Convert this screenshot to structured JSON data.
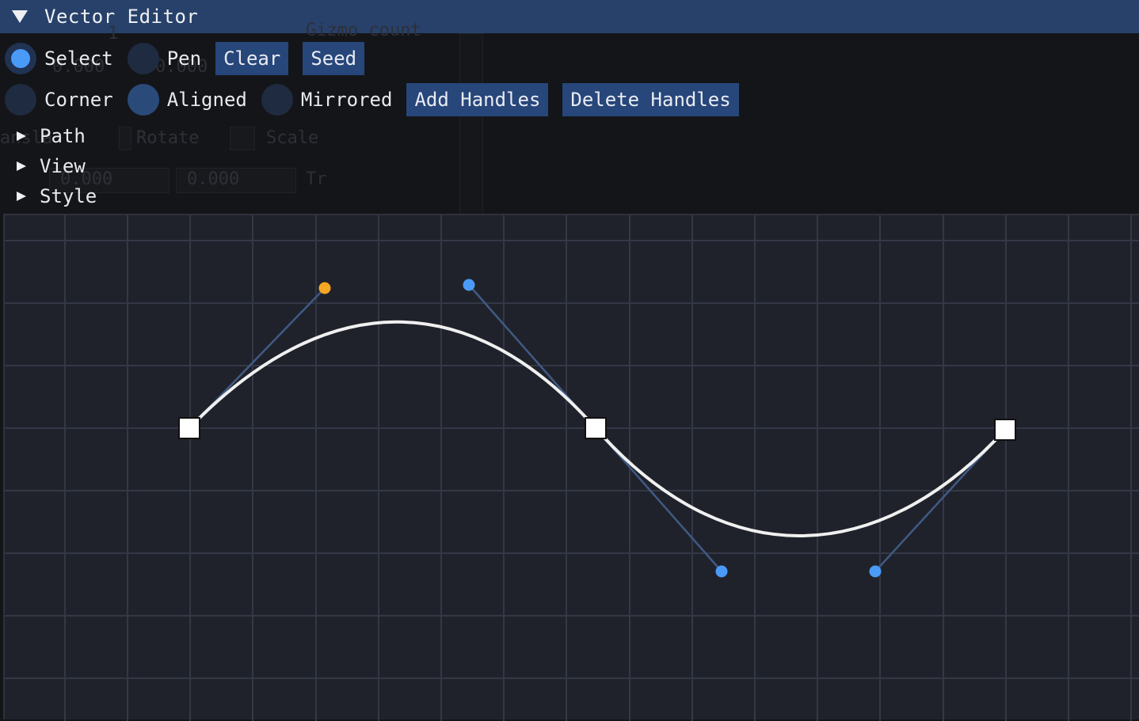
{
  "window": {
    "title": "Vector Editor"
  },
  "background_ghost": {
    "texts": [
      "1",
      "Gizmo count",
      "0.000",
      "0.000",
      "ansla",
      "Rotate",
      "Scale",
      "0.000",
      "0.000",
      "Tr"
    ]
  },
  "tool_modes": [
    {
      "label": "Select",
      "selected": true
    },
    {
      "label": "Pen",
      "selected": false
    }
  ],
  "toolbar_buttons": {
    "clear": "Clear",
    "seed": "Seed"
  },
  "handle_modes": [
    {
      "label": "Corner",
      "selected": false
    },
    {
      "label": "Aligned",
      "selected": true
    },
    {
      "label": "Mirrored",
      "selected": false
    }
  ],
  "handle_buttons": {
    "add": "Add Handles",
    "delete": "Delete Handles"
  },
  "sections": [
    {
      "label": "Path",
      "expanded": false
    },
    {
      "label": "View",
      "expanded": false
    },
    {
      "label": "Style",
      "expanded": false
    }
  ],
  "colors": {
    "title_bar": "#27416a",
    "button": "#27467a",
    "radio_active": "#4a9bf8",
    "canvas_bg": "#20222b",
    "grid_line": "#333846",
    "curve": "#f0f0f0",
    "handle_line": "#3f5a85",
    "handle_point": "#4a9bf8",
    "handle_point_selected": "#f5a623",
    "anchor_point": "#ffffff"
  },
  "icons": {
    "title_collapse": "triangle-down-icon",
    "section_expand": "triangle-right-icon"
  }
}
